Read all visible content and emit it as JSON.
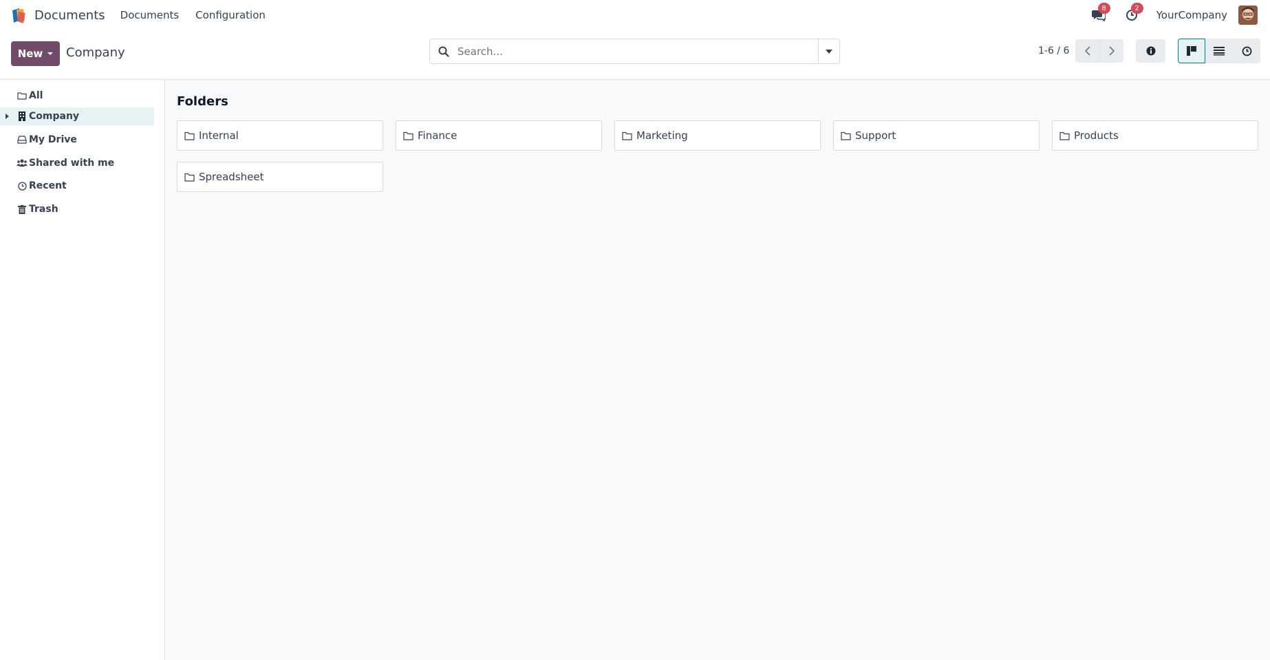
{
  "app": {
    "title": "Documents",
    "menu": [
      "Documents",
      "Configuration"
    ]
  },
  "systray": {
    "messages_count": "8",
    "activities_count": "2",
    "company": "YourCompany"
  },
  "control": {
    "new_label": "New",
    "breadcrumb": "Company",
    "search_placeholder": "Search...",
    "pager": "1-6 / 6"
  },
  "sidebar": {
    "items": [
      {
        "label": "All",
        "icon": "folder-outline-icon"
      },
      {
        "label": "Company",
        "icon": "building-icon",
        "selected": true
      },
      {
        "label": "My Drive",
        "icon": "drive-icon"
      },
      {
        "label": "Shared with me",
        "icon": "users-icon"
      },
      {
        "label": "Recent",
        "icon": "clock-icon"
      },
      {
        "label": "Trash",
        "icon": "trash-icon"
      }
    ]
  },
  "main": {
    "section_title": "Folders",
    "folders": [
      "Internal",
      "Finance",
      "Marketing",
      "Support",
      "Products",
      "Spreadsheet"
    ]
  },
  "colors": {
    "brand": "#714b67",
    "accent": "#017e84",
    "badge": "#d44c59"
  }
}
